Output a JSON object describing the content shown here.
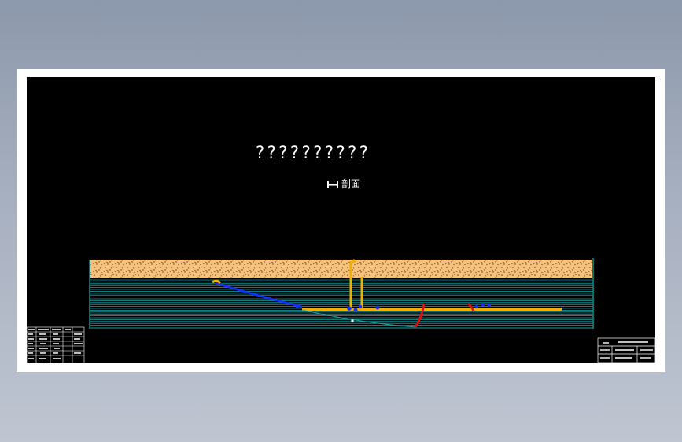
{
  "drawing": {
    "title": "??????????",
    "section_label": "剖面"
  },
  "colors": {
    "background": "#000000",
    "sheet_border": "#ffffff",
    "overburden_fill": "#f6c27e",
    "overburden_speckle": "#5a3a14",
    "strata_lines": "#1aa2a8",
    "strata_edge": "#0d6e6e",
    "roadway": "#f0b000",
    "borehole": "#1030ff",
    "fault": "#e01010"
  },
  "icons": {
    "section_mark": "section-mark-icon"
  }
}
